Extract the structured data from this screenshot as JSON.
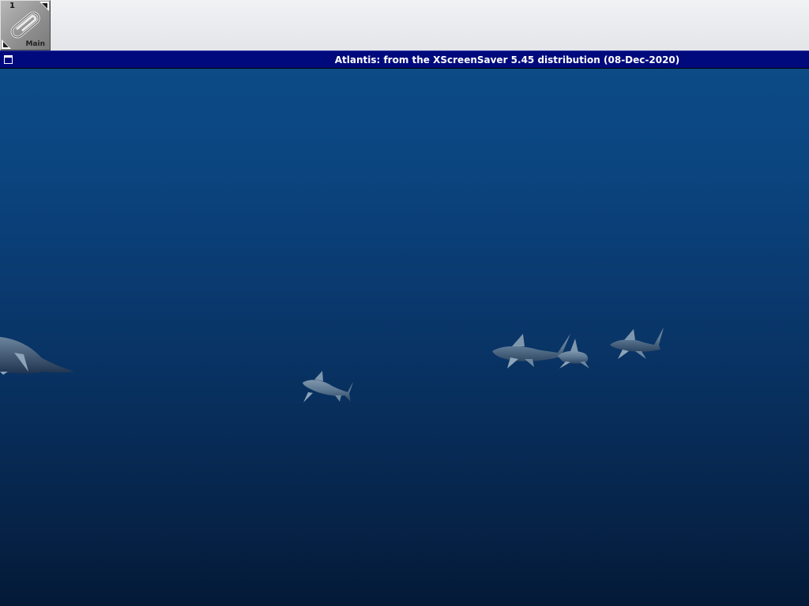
{
  "dock": {
    "workspace_number": "1",
    "workspace_name": "Main"
  },
  "window": {
    "title": "Atlantis: from the XScreenSaver 5.45 distribution (08-Dec-2020)"
  },
  "colors": {
    "titlebar": "#000a7c",
    "ocean_top": "#0c4b86",
    "ocean_bottom": "#041a37",
    "shark": "#5d7891"
  }
}
